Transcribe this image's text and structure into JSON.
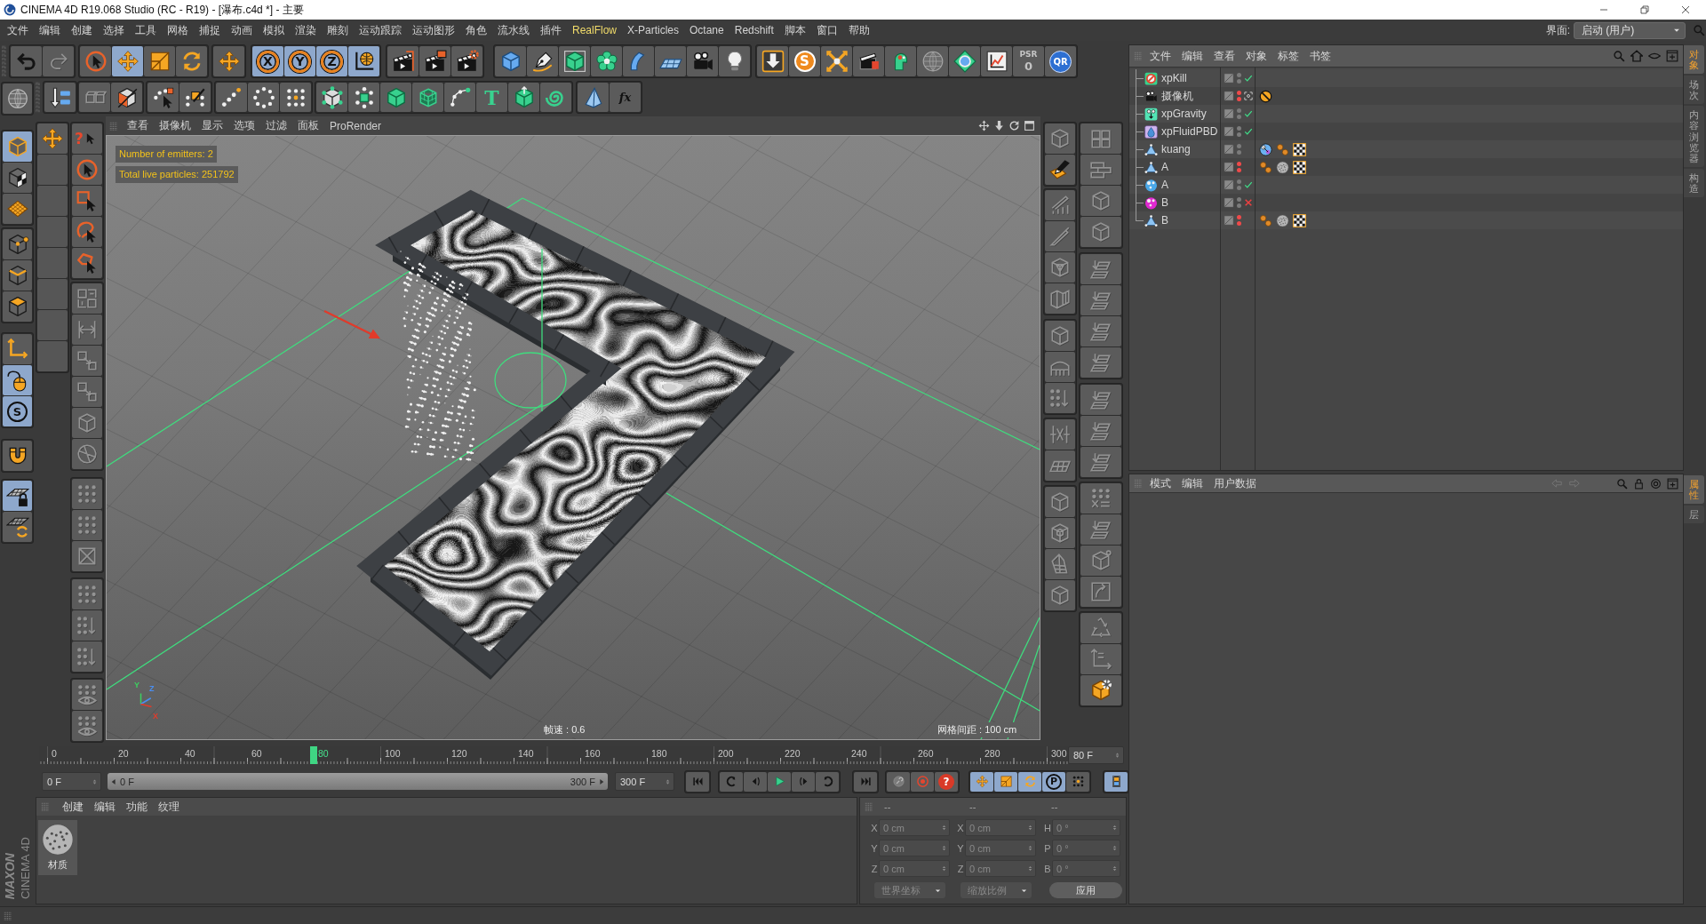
{
  "window": {
    "title": "CINEMA 4D R19.068 Studio (RC - R19) - [瀑布.c4d *] - 主要"
  },
  "menu_bar": {
    "items": [
      {
        "label": "文件",
        "highlighted": false
      },
      {
        "label": "编辑",
        "highlighted": false
      },
      {
        "label": "创建",
        "highlighted": false
      },
      {
        "label": "选择",
        "highlighted": false
      },
      {
        "label": "工具",
        "highlighted": false
      },
      {
        "label": "网格",
        "highlighted": false
      },
      {
        "label": "捕捉",
        "highlighted": false
      },
      {
        "label": "动画",
        "highlighted": false
      },
      {
        "label": "模拟",
        "highlighted": false
      },
      {
        "label": "渲染",
        "highlighted": false
      },
      {
        "label": "雕刻",
        "highlighted": false
      },
      {
        "label": "运动跟踪",
        "highlighted": false
      },
      {
        "label": "运动图形",
        "highlighted": false
      },
      {
        "label": "角色",
        "highlighted": false
      },
      {
        "label": "流水线",
        "highlighted": false
      },
      {
        "label": "插件",
        "highlighted": false
      },
      {
        "label": "RealFlow",
        "highlighted": true
      },
      {
        "label": "X-Particles",
        "highlighted": false
      },
      {
        "label": "Octane",
        "highlighted": false
      },
      {
        "label": "Redshift",
        "highlighted": false
      },
      {
        "label": "脚本",
        "highlighted": false
      },
      {
        "label": "窗口",
        "highlighted": false
      },
      {
        "label": "帮助",
        "highlighted": false
      }
    ],
    "layout_label": "界面:",
    "layout_value": "启动 (用户)"
  },
  "main_toolbar": [
    [
      {
        "selected": false,
        "disabled": false
      },
      {
        "selected": false,
        "disabled": true
      }
    ],
    [
      {
        "selected": false,
        "disabled": false
      },
      {
        "selected": true,
        "disabled": false
      },
      {
        "selected": false,
        "disabled": false
      },
      {
        "selected": false,
        "disabled": false
      }
    ],
    [
      {
        "selected": false,
        "disabled": false
      }
    ],
    [
      {
        "glyph": "X",
        "selected": true,
        "disabled": false
      },
      {
        "glyph": "Y",
        "selected": true,
        "disabled": false
      },
      {
        "glyph": "Z",
        "selected": true,
        "disabled": false
      },
      {
        "selected": true,
        "disabled": false
      }
    ],
    [
      {
        "selected": false,
        "disabled": false
      },
      {
        "selected": false,
        "disabled": false
      },
      {
        "selected": false,
        "disabled": false
      }
    ],
    [
      {
        "selected": false,
        "disabled": false
      },
      {
        "selected": false,
        "disabled": false
      },
      {
        "selected": false,
        "disabled": false
      },
      {
        "selected": false,
        "disabled": false
      },
      {
        "selected": false,
        "disabled": false
      },
      {
        "selected": false,
        "disabled": false
      },
      {
        "selected": false,
        "disabled": false
      },
      {
        "selected": false,
        "disabled": false
      }
    ],
    [
      {
        "selected": false,
        "disabled": false
      },
      {
        "glyph": "S",
        "selected": false,
        "disabled": false
      },
      {
        "selected": false,
        "disabled": false
      },
      {
        "selected": false,
        "disabled": false
      },
      {
        "selected": false,
        "disabled": false
      },
      {
        "selected": false,
        "disabled": false
      },
      {
        "selected": false,
        "disabled": false
      },
      {
        "selected": false,
        "disabled": false
      },
      {
        "glyph": "PSR",
        "sub_glyph": "0",
        "selected": false,
        "disabled": false
      },
      {
        "glyph": "QR",
        "selected": false,
        "disabled": false
      }
    ]
  ],
  "mode_toolbar": [
    [
      {
        "selected": false,
        "disabled": false
      }
    ],
    [
      {
        "selected": false,
        "disabled": true
      },
      {
        "selected": false,
        "disabled": false
      }
    ],
    [
      {
        "selected": false,
        "disabled": false
      },
      {
        "selected": false,
        "disabled": false
      }
    ],
    [
      {
        "selected": false,
        "disabled": false
      },
      {
        "selected": false,
        "disabled": false
      },
      {
        "selected": false,
        "disabled": false
      }
    ],
    [
      {
        "selected": false,
        "disabled": false
      },
      {
        "selected": false,
        "disabled": false
      },
      {
        "selected": false,
        "disabled": false
      },
      {
        "selected": false,
        "disabled": false
      },
      {
        "selected": false,
        "disabled": false
      },
      {
        "glyph": "T",
        "selected": false,
        "disabled": false
      },
      {
        "selected": false,
        "disabled": false
      },
      {
        "selected": false,
        "disabled": false
      }
    ],
    [
      {
        "selected": false,
        "disabled": false
      },
      {
        "glyph": "fx",
        "selected": false,
        "disabled": false
      }
    ]
  ],
  "left_palette": [
    [
      {
        "selected": false,
        "disabled": false
      }
    ],
    [
      {
        "selected": true,
        "disabled": false
      },
      {
        "selected": false,
        "disabled": false
      },
      {
        "selected": false,
        "disabled": false
      }
    ],
    [
      {
        "selected": false,
        "disabled": false
      },
      {
        "selected": false,
        "disabled": false
      },
      {
        "selected": false,
        "disabled": false
      }
    ],
    [
      {
        "selected": false,
        "disabled": false
      },
      {
        "selected": true,
        "disabled": false
      },
      {
        "glyph": "S",
        "selected": true,
        "disabled": false
      }
    ],
    [
      {
        "selected": false,
        "disabled": false
      }
    ],
    [
      {
        "selected": true,
        "disabled": false
      },
      {
        "selected": false,
        "disabled": false
      }
    ]
  ],
  "tool_palette": [
    [
      {
        "selected": false,
        "disabled": false
      }
    ]
  ],
  "select_palette": [
    [
      {
        "glyph": "?",
        "selected": false,
        "disabled": false
      },
      {
        "selected": false,
        "disabled": false
      },
      {
        "selected": false,
        "disabled": false
      },
      {
        "selected": false,
        "disabled": false
      },
      {
        "selected": false,
        "disabled": false
      }
    ],
    [
      {
        "selected": false,
        "disabled": true
      },
      {
        "selected": false,
        "disabled": true
      },
      {
        "selected": false,
        "disabled": true
      },
      {
        "selected": false,
        "disabled": true
      },
      {
        "selected": false,
        "disabled": true
      },
      {
        "selected": false,
        "disabled": true
      }
    ],
    [
      {
        "selected": false,
        "disabled": true
      },
      {
        "selected": false,
        "disabled": true
      },
      {
        "selected": false,
        "disabled": true
      }
    ],
    [
      {
        "selected": false,
        "disabled": true
      },
      {
        "selected": false,
        "disabled": true
      },
      {
        "selected": false,
        "disabled": true
      }
    ],
    [
      {
        "selected": false,
        "disabled": true
      },
      {
        "selected": false,
        "disabled": true
      }
    ]
  ],
  "right_palette_a": [
    [
      {
        "selected": false,
        "disabled": true
      },
      {
        "selected": false,
        "disabled": false
      }
    ],
    [
      {
        "selected": false,
        "disabled": true
      },
      {
        "selected": false,
        "disabled": true
      },
      {
        "selected": false,
        "disabled": true
      },
      {
        "selected": false,
        "disabled": true
      }
    ],
    [
      {
        "selected": false,
        "disabled": true
      },
      {
        "selected": false,
        "disabled": true
      },
      {
        "selected": false,
        "disabled": true
      }
    ],
    [
      {
        "selected": false,
        "disabled": true
      },
      {
        "selected": false,
        "disabled": true
      }
    ],
    [
      {
        "selected": false,
        "disabled": true
      },
      {
        "selected": false,
        "disabled": true
      },
      {
        "selected": false,
        "disabled": true
      },
      {
        "selected": false,
        "disabled": true
      }
    ]
  ],
  "right_palette_b": [
    [
      {
        "selected": false,
        "disabled": true
      },
      {
        "selected": false,
        "disabled": true
      },
      {
        "selected": false,
        "disabled": true
      },
      {
        "selected": false,
        "disabled": true
      }
    ],
    [
      {
        "selected": false,
        "disabled": true
      },
      {
        "selected": false,
        "disabled": true
      },
      {
        "selected": false,
        "disabled": true
      },
      {
        "selected": false,
        "disabled": true
      }
    ],
    [
      {
        "selected": false,
        "disabled": true
      },
      {
        "selected": false,
        "disabled": true
      },
      {
        "selected": false,
        "disabled": true
      }
    ],
    [
      {
        "selected": false,
        "disabled": true
      },
      {
        "selected": false,
        "disabled": true
      },
      {
        "selected": false,
        "disabled": true
      },
      {
        "selected": false,
        "disabled": true
      }
    ],
    [
      {
        "selected": false,
        "disabled": true
      },
      {
        "selected": false,
        "disabled": true
      },
      {
        "selected": false,
        "disabled": false
      }
    ]
  ],
  "viewport": {
    "menu": [
      "查看",
      "摄像机",
      "显示",
      "选项",
      "过滤",
      "面板",
      "ProRender"
    ],
    "stats": [
      "Number of emitters: 2",
      "Total live particles: 251792"
    ],
    "frame_rate": "帧速 : 0.6",
    "grid_spacing": "网格间距 : 100 cm",
    "gizmo_labels": [
      {
        "label": "Y",
        "color": "#3cd060"
      },
      {
        "label": "Z",
        "color": "#4a8ef0"
      },
      {
        "label": "X",
        "color": "#e23a2a"
      }
    ]
  },
  "object_manager": {
    "menu": [
      "文件",
      "编辑",
      "查看",
      "对象",
      "标签",
      "书签"
    ],
    "objects": [
      {
        "name": "xpKill",
        "kind": "kill",
        "hidden_in_editor": false,
        "hidden_in_render": false,
        "enabled": true
      },
      {
        "name": "摄像机",
        "kind": "camera",
        "hidden_in_editor": true,
        "hidden_in_render": true,
        "camera_active": false,
        "tags": [
          {
            "kind": "protection"
          }
        ]
      },
      {
        "name": "xpGravity",
        "kind": "gravity",
        "hidden_in_editor": false,
        "hidden_in_render": false,
        "enabled": true
      },
      {
        "name": "xpFluidPBD",
        "kind": "fluid",
        "hidden_in_editor": false,
        "hidden_in_render": false,
        "enabled": true
      },
      {
        "name": "kuang",
        "kind": "polygon",
        "hidden_in_editor": false,
        "hidden_in_render": false,
        "tags": [
          {
            "kind": "collider"
          },
          {
            "kind": "phong"
          },
          {
            "kind": "uvw"
          }
        ]
      },
      {
        "name": "A",
        "kind": "polygon",
        "hidden_in_editor": true,
        "hidden_in_render": true,
        "tags": [
          {
            "kind": "phong"
          },
          {
            "kind": "material"
          },
          {
            "kind": "uvw"
          }
        ]
      },
      {
        "name": "A",
        "kind": "emitter",
        "color": "#4aa8e8",
        "hidden_in_editor": false,
        "hidden_in_render": false,
        "enabled": true
      },
      {
        "name": "B",
        "kind": "emitter",
        "color": "#e02ad0",
        "hidden_in_editor": false,
        "hidden_in_render": false,
        "enabled": false
      },
      {
        "name": "B",
        "kind": "polygon",
        "hidden_in_editor": true,
        "hidden_in_render": true,
        "tags": [
          {
            "kind": "phong"
          },
          {
            "kind": "material"
          },
          {
            "kind": "uvw"
          }
        ]
      }
    ]
  },
  "attribute_manager": {
    "menu": [
      "模式",
      "编辑",
      "用户数据"
    ]
  },
  "side_tabs": {
    "upper": [
      {
        "label": "对象",
        "selected": true
      },
      {
        "label": "场次",
        "selected": false
      },
      {
        "label": "内容浏览器",
        "selected": false
      },
      {
        "label": "构造",
        "selected": false
      }
    ],
    "lower": [
      {
        "label": "属性",
        "selected": true
      },
      {
        "label": "层",
        "selected": false
      }
    ]
  },
  "timeline": {
    "ticks": [
      {
        "label": "0",
        "selected": false
      },
      {
        "label": "20",
        "selected": false
      },
      {
        "label": "40",
        "selected": false
      },
      {
        "label": "60",
        "selected": false
      },
      {
        "label": "80",
        "selected": true
      },
      {
        "label": "100",
        "selected": false
      },
      {
        "label": "120",
        "selected": false
      },
      {
        "label": "140",
        "selected": false
      },
      {
        "label": "160",
        "selected": false
      },
      {
        "label": "180",
        "selected": false
      },
      {
        "label": "200",
        "selected": false
      },
      {
        "label": "220",
        "selected": false
      },
      {
        "label": "240",
        "selected": false
      },
      {
        "label": "260",
        "selected": false
      },
      {
        "label": "280",
        "selected": false
      },
      {
        "label": "300",
        "selected": false
      }
    ],
    "level": 0.2667,
    "frame_field": "80 F"
  },
  "transport": {
    "start_field": "0 F",
    "range": {
      "start": "0 F",
      "end": "300 F",
      "level": 1
    },
    "end_field": "300 F",
    "buttons": [
      [
        {
          "selected": false,
          "disabled": false
        }
      ],
      [
        {
          "selected": false,
          "disabled": false
        },
        {
          "selected": false,
          "disabled": false
        },
        {
          "selected": false,
          "disabled": false
        },
        {
          "selected": false,
          "disabled": false
        },
        {
          "selected": false,
          "disabled": false
        }
      ],
      [
        {
          "selected": false,
          "disabled": false
        }
      ],
      [
        {
          "selected": false,
          "disabled": false
        },
        {
          "selected": false,
          "disabled": false
        },
        {
          "glyph": "?",
          "selected": false,
          "disabled": false
        }
      ],
      [
        {
          "selected": true,
          "disabled": false
        },
        {
          "selected": true,
          "disabled": false
        },
        {
          "selected": true,
          "disabled": false
        },
        {
          "glyph": "P",
          "selected": true,
          "disabled": false
        },
        {
          "selected": false,
          "disabled": false
        }
      ],
      [
        {
          "selected": true,
          "disabled": false
        }
      ]
    ]
  },
  "materials": {
    "menu": [
      "创建",
      "编辑",
      "功能",
      "纹理"
    ],
    "items": [
      {
        "name": "材质"
      }
    ]
  },
  "coordinates": {
    "disabled": true,
    "headers": [
      "--",
      "--",
      "--"
    ],
    "rows": [
      [
        {
          "axis": "X",
          "value": "0 cm"
        },
        {
          "axis": "X",
          "value": "0 cm"
        },
        {
          "axis": "H",
          "value": "0 °"
        }
      ],
      [
        {
          "axis": "Y",
          "value": "0 cm"
        },
        {
          "axis": "Y",
          "value": "0 cm"
        },
        {
          "axis": "P",
          "value": "0 °"
        }
      ],
      [
        {
          "axis": "Z",
          "value": "0 cm"
        },
        {
          "axis": "Z",
          "value": "0 cm"
        },
        {
          "axis": "B",
          "value": "0 °"
        }
      ]
    ],
    "dropdowns": [
      "世界坐标",
      "缩放比例"
    ],
    "apply": "应用"
  },
  "logo": {
    "brand": "MAXON",
    "product": "CINEMA 4D"
  }
}
